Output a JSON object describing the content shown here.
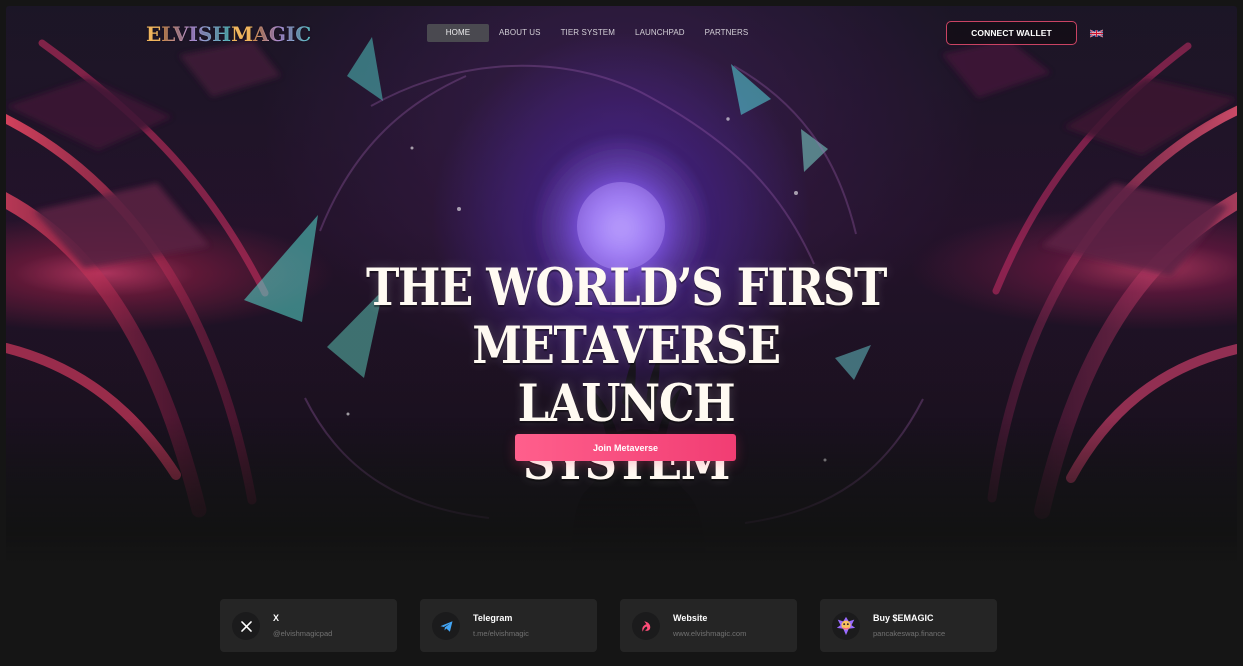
{
  "brand": {
    "logo_first": "E",
    "logo_mid": "LVISH ",
    "logo_second_initial": "M",
    "logo_tail": "AGIC",
    "colors": {
      "accent_pink": "#ff4f7f",
      "wallet_border": "#ff5279",
      "background": "#151515",
      "card_background": "#252525"
    }
  },
  "nav": {
    "items": [
      {
        "label": "HOME",
        "active": true
      },
      {
        "label": "ABOUT US",
        "active": false
      },
      {
        "label": "TIER SYSTEM",
        "active": false
      },
      {
        "label": "LAUNCHPAD",
        "active": false
      },
      {
        "label": "PARTNERS",
        "active": false
      }
    ]
  },
  "header": {
    "wallet_button_label": "CONNECT WALLET",
    "language_icon": "uk-flag-icon"
  },
  "hero": {
    "title_line_1": "THE WORLD’S FIRST",
    "title_line_2": "METAVERSE LAUNCH",
    "title_line_3": "SYSTEM",
    "cta_label": "Join Metaverse"
  },
  "links": [
    {
      "icon": "x-icon",
      "title": "X",
      "subtitle": "@elvishmagicpad"
    },
    {
      "icon": "telegram-icon",
      "title": "Telegram",
      "subtitle": "t.me/elvishmagic"
    },
    {
      "icon": "website-icon",
      "title": "Website",
      "subtitle": "www.elvishmagic.com"
    },
    {
      "icon": "pancakeswap-icon",
      "title": "Buy $EMAGIC",
      "subtitle": "pancakeswap.finance"
    }
  ]
}
